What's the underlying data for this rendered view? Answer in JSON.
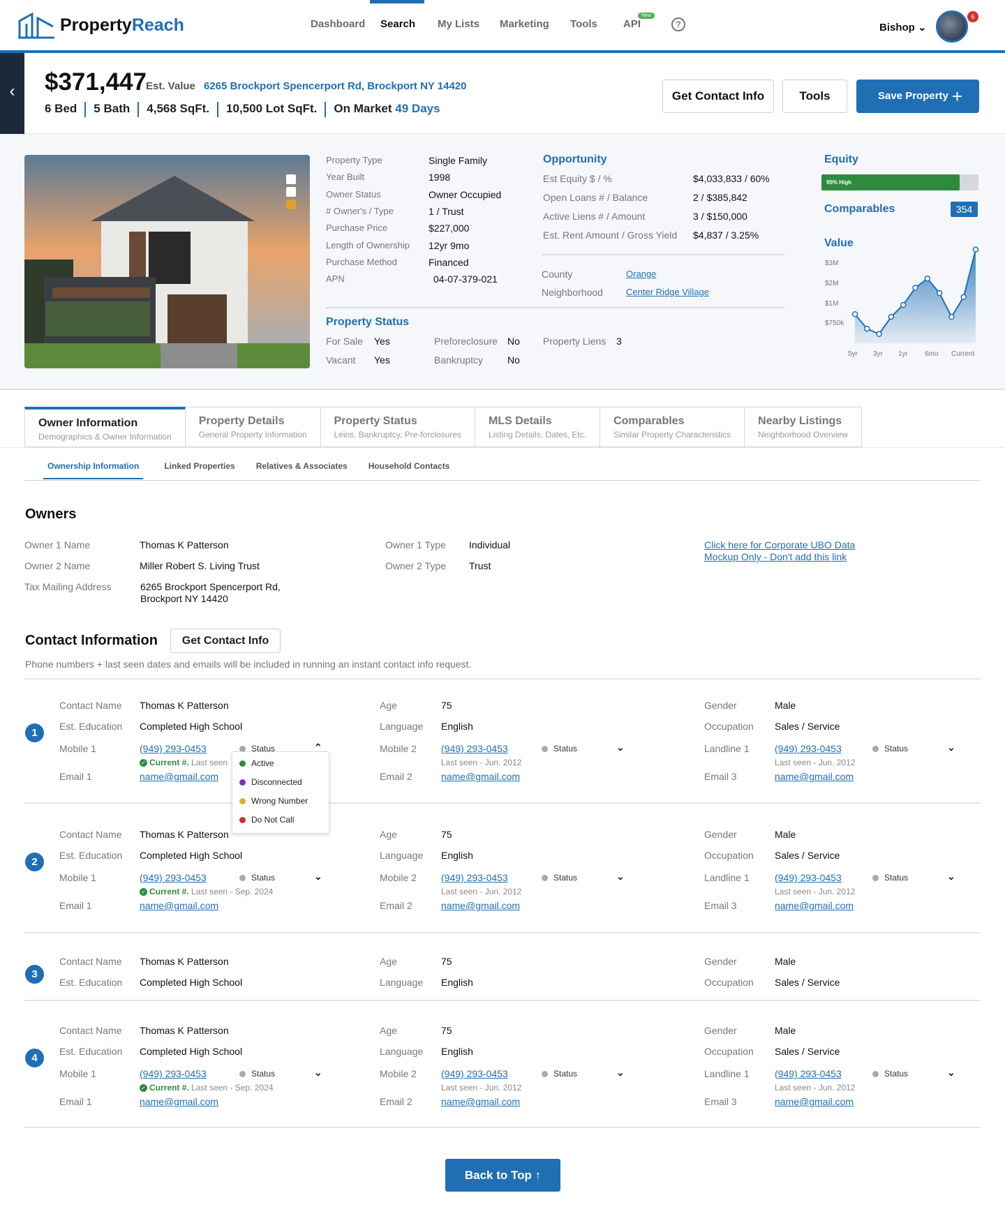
{
  "nav": {
    "logo_part1": "Property",
    "logo_part2": "Reach",
    "links": [
      "Dashboard",
      "Search",
      "My Lists",
      "Marketing",
      "Tools",
      "API"
    ],
    "api_badge": "New",
    "user": "Bishop",
    "notifications": "6",
    "help": "?"
  },
  "header": {
    "price": "$371,447",
    "est_label": "Est. Value",
    "address": "6265 Brockport Spencerport Rd, Brockport NY 14420",
    "beds": "6 Bed",
    "baths": "5 Bath",
    "sqft": "4,568 SqFt.",
    "lot": "10,500 Lot SqFt.",
    "market_label": "On Market",
    "market_days": "49 Days",
    "btn_contact": "Get Contact Info",
    "btn_tools": "Tools",
    "btn_save": "Save Property"
  },
  "details": [
    {
      "k": "Property Type",
      "v": "Single Family"
    },
    {
      "k": "Year Built",
      "v": "1998"
    },
    {
      "k": "Owner Status",
      "v": "Owner Occupied"
    },
    {
      "k": "# Owner's / Type",
      "v": "1 / Trust"
    },
    {
      "k": "Purchase Price",
      "v": "$227,000"
    },
    {
      "k": "Length of Ownership",
      "v": "12yr 9mo"
    },
    {
      "k": "Purchase Method",
      "v": "Financed"
    },
    {
      "k": "APN",
      "v": "04-07-379-021"
    }
  ],
  "opportunity": {
    "title": "Opportunity",
    "rows": [
      {
        "k": "Est Equity $ / %",
        "v": "$4,033,833 / 60%"
      },
      {
        "k": "Open Loans # / Balance",
        "v": "2 / $385,842"
      },
      {
        "k": "Active Liens # / Amount",
        "v": "3 / $150,000"
      },
      {
        "k": "Est. Rent Amount / Gross Yield",
        "v": "$4,837 / 3.25%"
      }
    ],
    "county_label": "County",
    "county": "Orange",
    "neighborhood_label": "Neighborhood",
    "neighborhood": "Center Ridge Village"
  },
  "property_status": {
    "title": "Property Status",
    "for_sale_label": "For Sale",
    "for_sale": "Yes",
    "vacant_label": "Vacant",
    "vacant": "Yes",
    "preforeclosure_label": "Preforeclosure",
    "preforeclosure": "No",
    "bankruptcy_label": "Bankruptcy",
    "bankruptcy": "No",
    "liens_label": "Property Liens",
    "liens": "3"
  },
  "equity": {
    "title": "Equity",
    "label": "95% High",
    "fraction": 0.88
  },
  "comparables": {
    "title": "Comparables",
    "count": "354"
  },
  "value_title": "Value",
  "chart_data": {
    "type": "area",
    "x": [
      "5yr",
      "",
      "3yr",
      "",
      "",
      "1yr",
      "",
      "",
      "6mo",
      "",
      "Current"
    ],
    "values": [
      1.1,
      0.55,
      0.35,
      1.0,
      1.45,
      2.1,
      2.45,
      1.9,
      1.0,
      1.75,
      3.55
    ],
    "y_ticks": [
      "$750k",
      "$1M",
      "$2M",
      "$3M"
    ],
    "x_ticks": [
      "5yr",
      "3yr",
      "1yr",
      "6mo",
      "Current"
    ],
    "color": "#1f6fb5"
  },
  "tabs": [
    {
      "title": "Owner Information",
      "sub": "Demographics & Owner Information"
    },
    {
      "title": "Property Details",
      "sub": "General Property Information"
    },
    {
      "title": "Property Status",
      "sub": "Leins, Bankruptcy, Pre-forclosures"
    },
    {
      "title": "MLS Details",
      "sub": "Listing Details, Dates, Etc."
    },
    {
      "title": "Comparables",
      "sub": "Similar Property Characteristics"
    },
    {
      "title": "Nearby Listings",
      "sub": "Neighborhood Overview"
    }
  ],
  "subtabs": [
    "Ownership Information",
    "Linked Properties",
    "Relatives & Associates",
    "Household Contacts"
  ],
  "owners": {
    "title": "Owners",
    "o1_label": "Owner 1 Name",
    "o1": "Thomas K Patterson",
    "o2_label": "Owner 2 Name",
    "o2": "Miller Robert S. Living Trust",
    "tax_label": "Tax Mailing Address",
    "tax_line1": "6265 Brockport Spencerport Rd,",
    "tax_line2": "Brockport NY 14420",
    "t1_label": "Owner 1 Type",
    "t1": "Individual",
    "t2_label": "Owner 2 Type",
    "t2": "Trust",
    "ubo_link1": "Click here for Corporate UBO Data",
    "ubo_link2": "Mockup Only - Don't add this link"
  },
  "contact": {
    "title": "Contact Information",
    "btn": "Get Contact Info",
    "note": "Phone numbers + last seen dates and emails will be included in running an instant contact info request.",
    "labels": {
      "name": "Contact Name",
      "edu": "Est. Education",
      "mobile1": "Mobile 1",
      "email1": "Email 1",
      "age": "Age",
      "lang": "Language",
      "mobile2": "Mobile 2",
      "email2": "Email 2",
      "gender": "Gender",
      "occ": "Occupation",
      "landline": "Landline 1",
      "email3": "Email 3",
      "status": "Status",
      "current": "Current #.",
      "last_seen_prefix": "Last seen"
    },
    "person": {
      "name": "Thomas K Patterson",
      "edu": "Completed High School",
      "age": "75",
      "lang": "English",
      "gender": "Male",
      "occ": "Sales / Service",
      "phone": "(949) 293-0453",
      "email": "name@gmail.com",
      "seen_recent": "Last seen - Sep. 2024",
      "seen_old": "Last seen - Jun. 2012"
    },
    "numbers": [
      "1",
      "2",
      "3",
      "4"
    ],
    "status_options": [
      {
        "label": "Active",
        "color": "#2e8b3d"
      },
      {
        "label": "Disconnected",
        "color": "#7b2fbe"
      },
      {
        "label": "Wrong Number",
        "color": "#e0b030"
      },
      {
        "label": "Do Not Call",
        "color": "#d32f2f"
      }
    ]
  },
  "back_to_top": "Back to Top"
}
